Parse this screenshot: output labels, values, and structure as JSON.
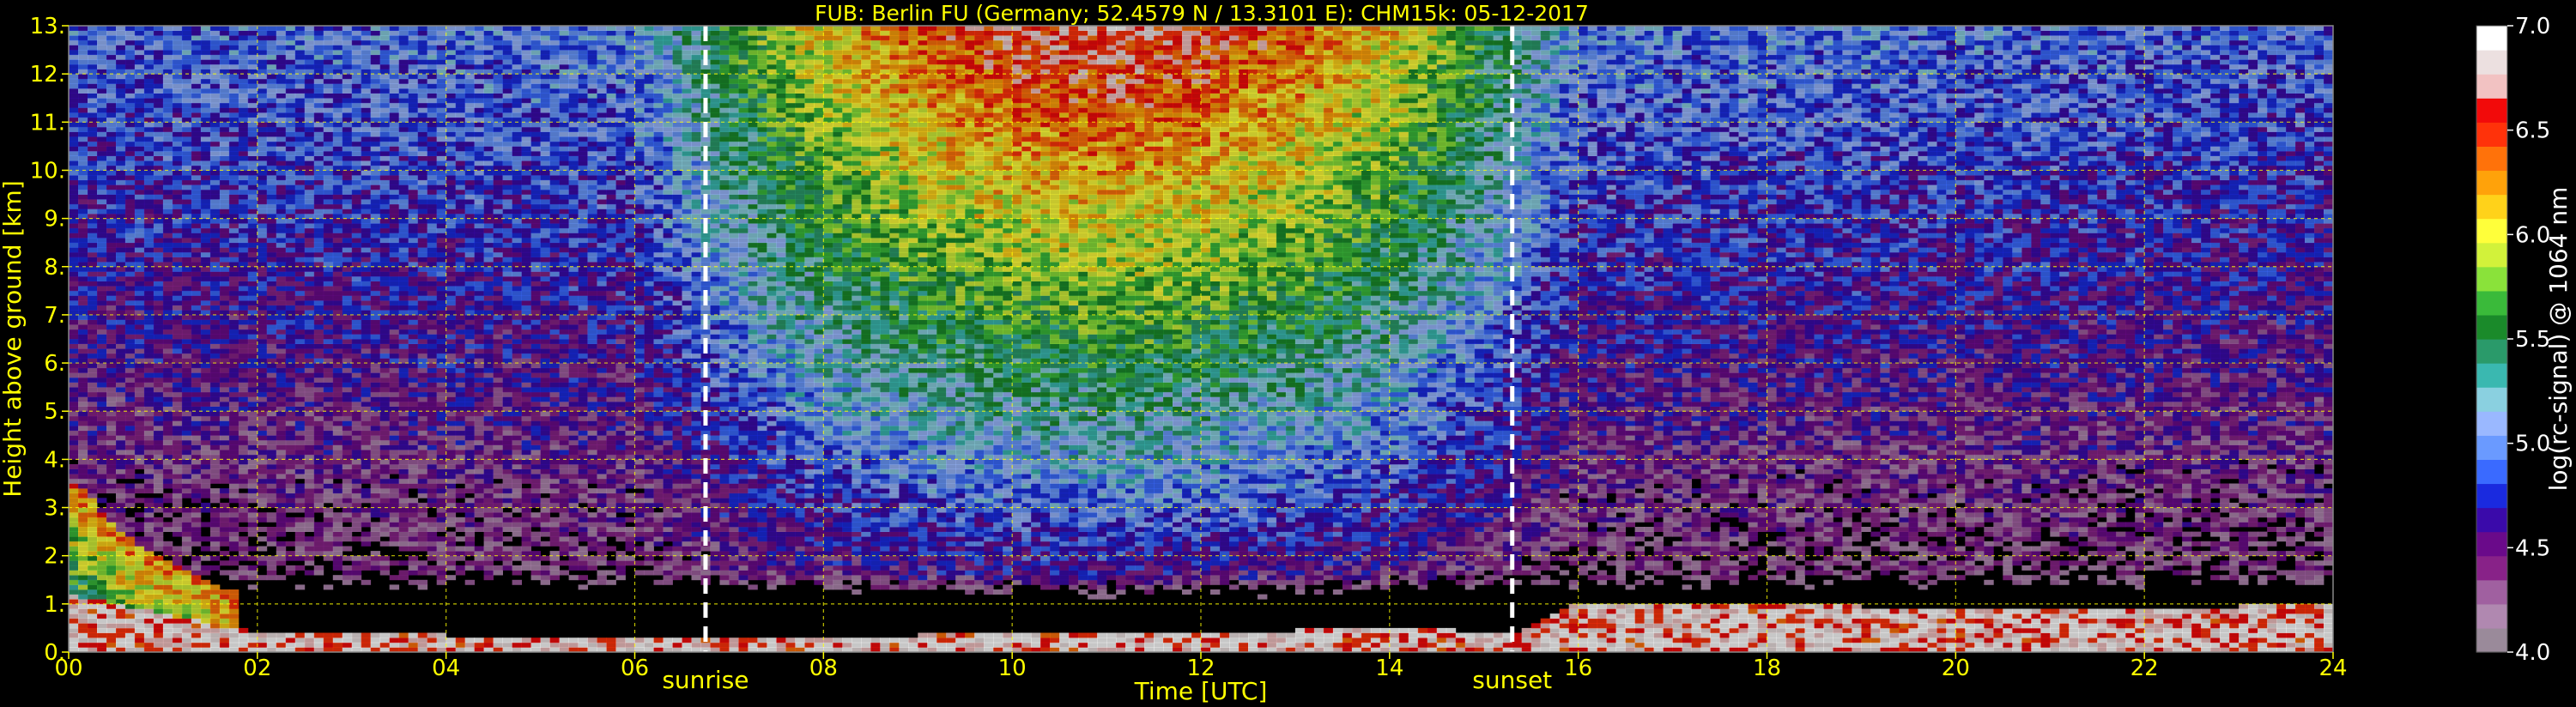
{
  "chart_data": {
    "type": "heatmap",
    "title": "FUB: Berlin FU (Germany; 52.4579 N / 13.3101 E):    CHM15k: 05-12-2017",
    "xlabel": "Time [UTC]",
    "ylabel": "Height above ground [km]",
    "colorbar_label": "log(rc-signal) @ 1064 nm",
    "xlim": [
      0,
      24
    ],
    "ylim": [
      0,
      13
    ],
    "clim": [
      4.0,
      7.0
    ],
    "x_ticks": [
      0,
      2,
      4,
      6,
      8,
      10,
      12,
      14,
      16,
      18,
      20,
      22,
      24
    ],
    "x_tick_labels": [
      "00",
      "02",
      "04",
      "06",
      "08",
      "10",
      "12",
      "14",
      "16",
      "18",
      "20",
      "22",
      "24"
    ],
    "y_ticks": [
      0,
      1,
      2,
      3,
      4,
      5,
      6,
      7,
      8,
      9,
      10,
      11,
      12,
      13
    ],
    "y_tick_labels": [
      "0.",
      "1.",
      "2.",
      "3.",
      "4.",
      "5.",
      "6.",
      "7.",
      "8.",
      "9.",
      "10.",
      "11.",
      "12.",
      "13."
    ],
    "colorbar_ticks": [
      4.0,
      4.5,
      5.0,
      5.5,
      6.0,
      6.5,
      7.0
    ],
    "colorbar_tick_labels": [
      "4.0",
      "4.5",
      "5.0",
      "5.5",
      "6.0",
      "6.5",
      "7.0"
    ],
    "colormap": [
      "#9a8a9a",
      "#b088b0",
      "#a060a0",
      "#882288",
      "#6a0a8a",
      "#3a0aaa",
      "#1a2adf",
      "#3a6aff",
      "#6a9aff",
      "#9ab8ff",
      "#8ad0e0",
      "#3ab8b0",
      "#2a9a6a",
      "#1a8a2a",
      "#3aba3a",
      "#8ae23a",
      "#d2f23a",
      "#ffff3a",
      "#ffd21a",
      "#ffa20a",
      "#ff720a",
      "#ff320a",
      "#f20a0a",
      "#f2c2c2",
      "#ece0e0",
      "#ffffff"
    ],
    "vertical_markers": [
      {
        "x": 6.75,
        "label": "sunrise"
      },
      {
        "x": 15.3,
        "label": "sunset"
      }
    ],
    "grid": true,
    "grid_color": "#ffff00",
    "text_color": "#ffff00",
    "background": "#000000",
    "layers": [
      {
        "kind": "background_signal",
        "x": [
          0,
          6,
          7,
          8,
          9,
          10,
          11,
          12,
          13,
          14,
          15,
          16,
          24
        ],
        "level_at_top": [
          4.9,
          5.0,
          5.6,
          6.1,
          6.4,
          6.6,
          6.7,
          6.6,
          6.4,
          6.1,
          5.6,
          5.0,
          4.9
        ]
      },
      {
        "kind": "low_cloud",
        "x": [
          0,
          0.2,
          0.5,
          0.9,
          1.3,
          1.8
        ],
        "top_km": [
          3.6,
          3.3,
          2.6,
          2.0,
          1.7,
          1.2
        ],
        "peak_level": 6.3
      },
      {
        "kind": "boundary_layer",
        "x": [
          0,
          2,
          6,
          8,
          10,
          12,
          14,
          15.3,
          16,
          18,
          20,
          22,
          24
        ],
        "top_km": [
          1.2,
          0.4,
          0.3,
          0.3,
          0.4,
          0.4,
          0.5,
          0.4,
          1.0,
          1.0,
          0.9,
          0.9,
          1.0
        ],
        "peak_level": 6.8
      }
    ]
  }
}
